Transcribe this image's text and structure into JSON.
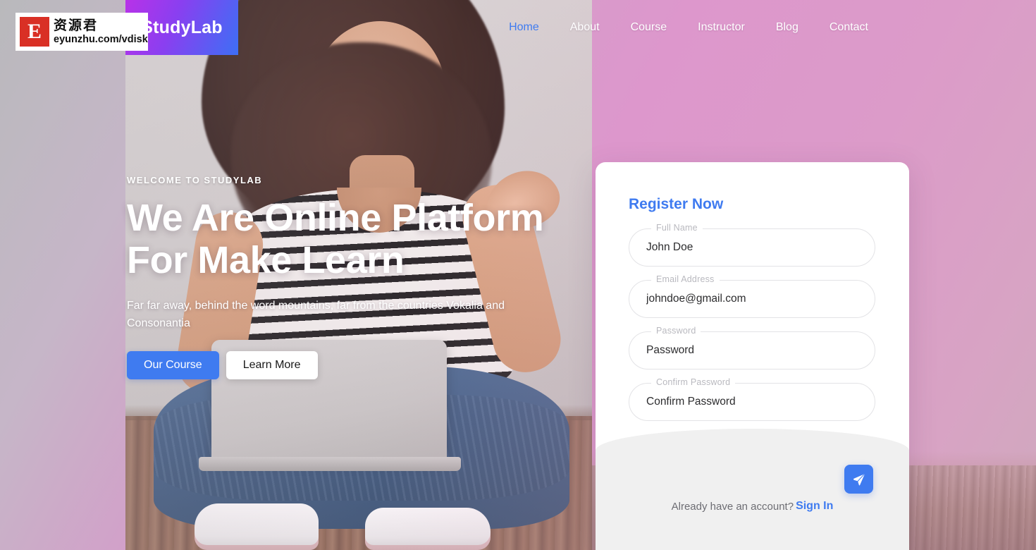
{
  "brand": {
    "logo_text": "StudyLab",
    "accent_blue": "#3f7bf0",
    "gradient_from": "#b832e8",
    "gradient_to": "#3d6ff5"
  },
  "nav": {
    "items": [
      {
        "label": "Home",
        "active": true
      },
      {
        "label": "About",
        "active": false
      },
      {
        "label": "Course",
        "active": false
      },
      {
        "label": "Instructor",
        "active": false
      },
      {
        "label": "Blog",
        "active": false
      },
      {
        "label": "Contact",
        "active": false
      }
    ]
  },
  "hero": {
    "kicker": "WELCOME TO STUDYLAB",
    "title_line1": "We Are Online Platform",
    "title_line2": "For Make Learn",
    "subtitle": "Far far away, behind the word mountains, far from the countries Vokalia and Consonantia",
    "primary_button": "Our Course",
    "secondary_button": "Learn More"
  },
  "register": {
    "title": "Register Now",
    "fields": [
      {
        "label": "Full Name",
        "value": "John Doe",
        "placeholder": "Full Name"
      },
      {
        "label": "Email Address",
        "value": "johndoe@gmail.com",
        "placeholder": "Email Address"
      },
      {
        "label": "Password",
        "value": "Password",
        "placeholder": "Password"
      },
      {
        "label": "Confirm Password",
        "value": "Confirm Password",
        "placeholder": "Confirm Password"
      }
    ],
    "submit_icon": "send-icon",
    "footer_text": "Already have an account?",
    "footer_link": "Sign In"
  },
  "watermark": {
    "mark_letter": "E",
    "chinese": "资源君",
    "url": "eyunzhu.com/vdisk"
  }
}
